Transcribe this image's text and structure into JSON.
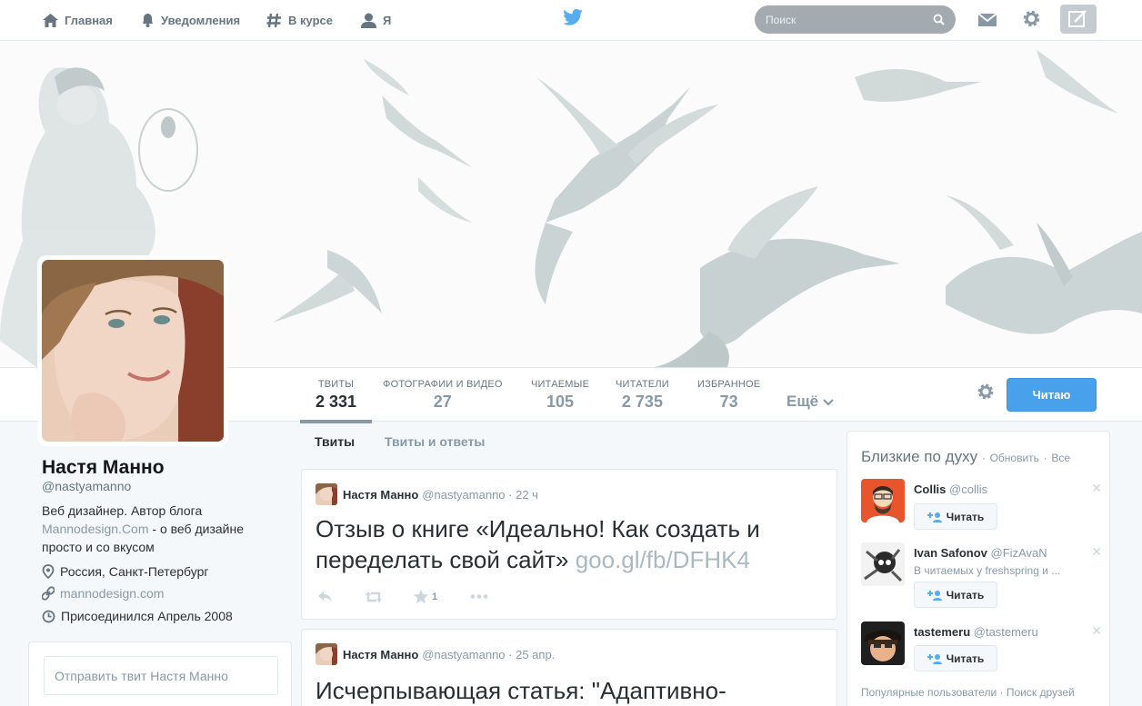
{
  "topnav": {
    "home": "Главная",
    "notifications": "Уведомления",
    "discover": "В курсе",
    "me": "Я",
    "search_placeholder": "Поиск"
  },
  "profile": {
    "name": "Настя Манно",
    "handle": "@nastyamanno",
    "bio_line1": "Веб дизайнер. Автор блога",
    "bio_link": "Mannodesign.Com",
    "bio_line2": " - о веб дизайне просто и со вкусом",
    "location": "Россия, Санкт-Петербург",
    "website": "mannodesign.com",
    "joined": "Присоединился Апрель 2008",
    "tweet_to_placeholder": "Отправить твит Настя Манно"
  },
  "stats": [
    {
      "label": "ТВИТЫ",
      "value": "2 331"
    },
    {
      "label": "ФОТОГРАФИИ И ВИДЕО",
      "value": "27"
    },
    {
      "label": "ЧИТАЕМЫЕ",
      "value": "105"
    },
    {
      "label": "ЧИТАТЕЛИ",
      "value": "2 735"
    },
    {
      "label": "ИЗБРАННОЕ",
      "value": "73"
    }
  ],
  "more_label": "Ещё",
  "follow_button": "Читаю",
  "timeline_tabs": {
    "tweets": "Твиты",
    "replies": "Твиты и ответы"
  },
  "tweets": [
    {
      "name": "Настя Манно",
      "handle": "@nastyamanno",
      "time": "· 22 ч",
      "text": "Отзыв о книге «Идеально! Как создать и переделать свой сайт» ",
      "link": "goo.gl/fb/DFHK4",
      "favorites": "1"
    },
    {
      "name": "Настя Манно",
      "handle": "@nastyamanno",
      "time": "· 25 апр.",
      "text": "Исчерпывающая статья: \"Адаптивно-"
    }
  ],
  "wtf": {
    "title": "Близкие по духу",
    "refresh": "Обновить",
    "all": "Все",
    "sep": "·",
    "follow_label": "Читать",
    "users": [
      {
        "name": "Collis",
        "handle": "@collis",
        "sub": ""
      },
      {
        "name": "Ivan Safonov",
        "handle": "@FizAvaN",
        "sub": "В читаемых у freshspring и ..."
      },
      {
        "name": "tastemeru",
        "handle": "@tastemeru",
        "sub": ""
      }
    ],
    "footer_popular": "Популярные пользователи",
    "footer_find": "Поиск друзей"
  },
  "colors": {
    "accent": "#4aa1eb",
    "twitter_blue": "#55acee"
  }
}
